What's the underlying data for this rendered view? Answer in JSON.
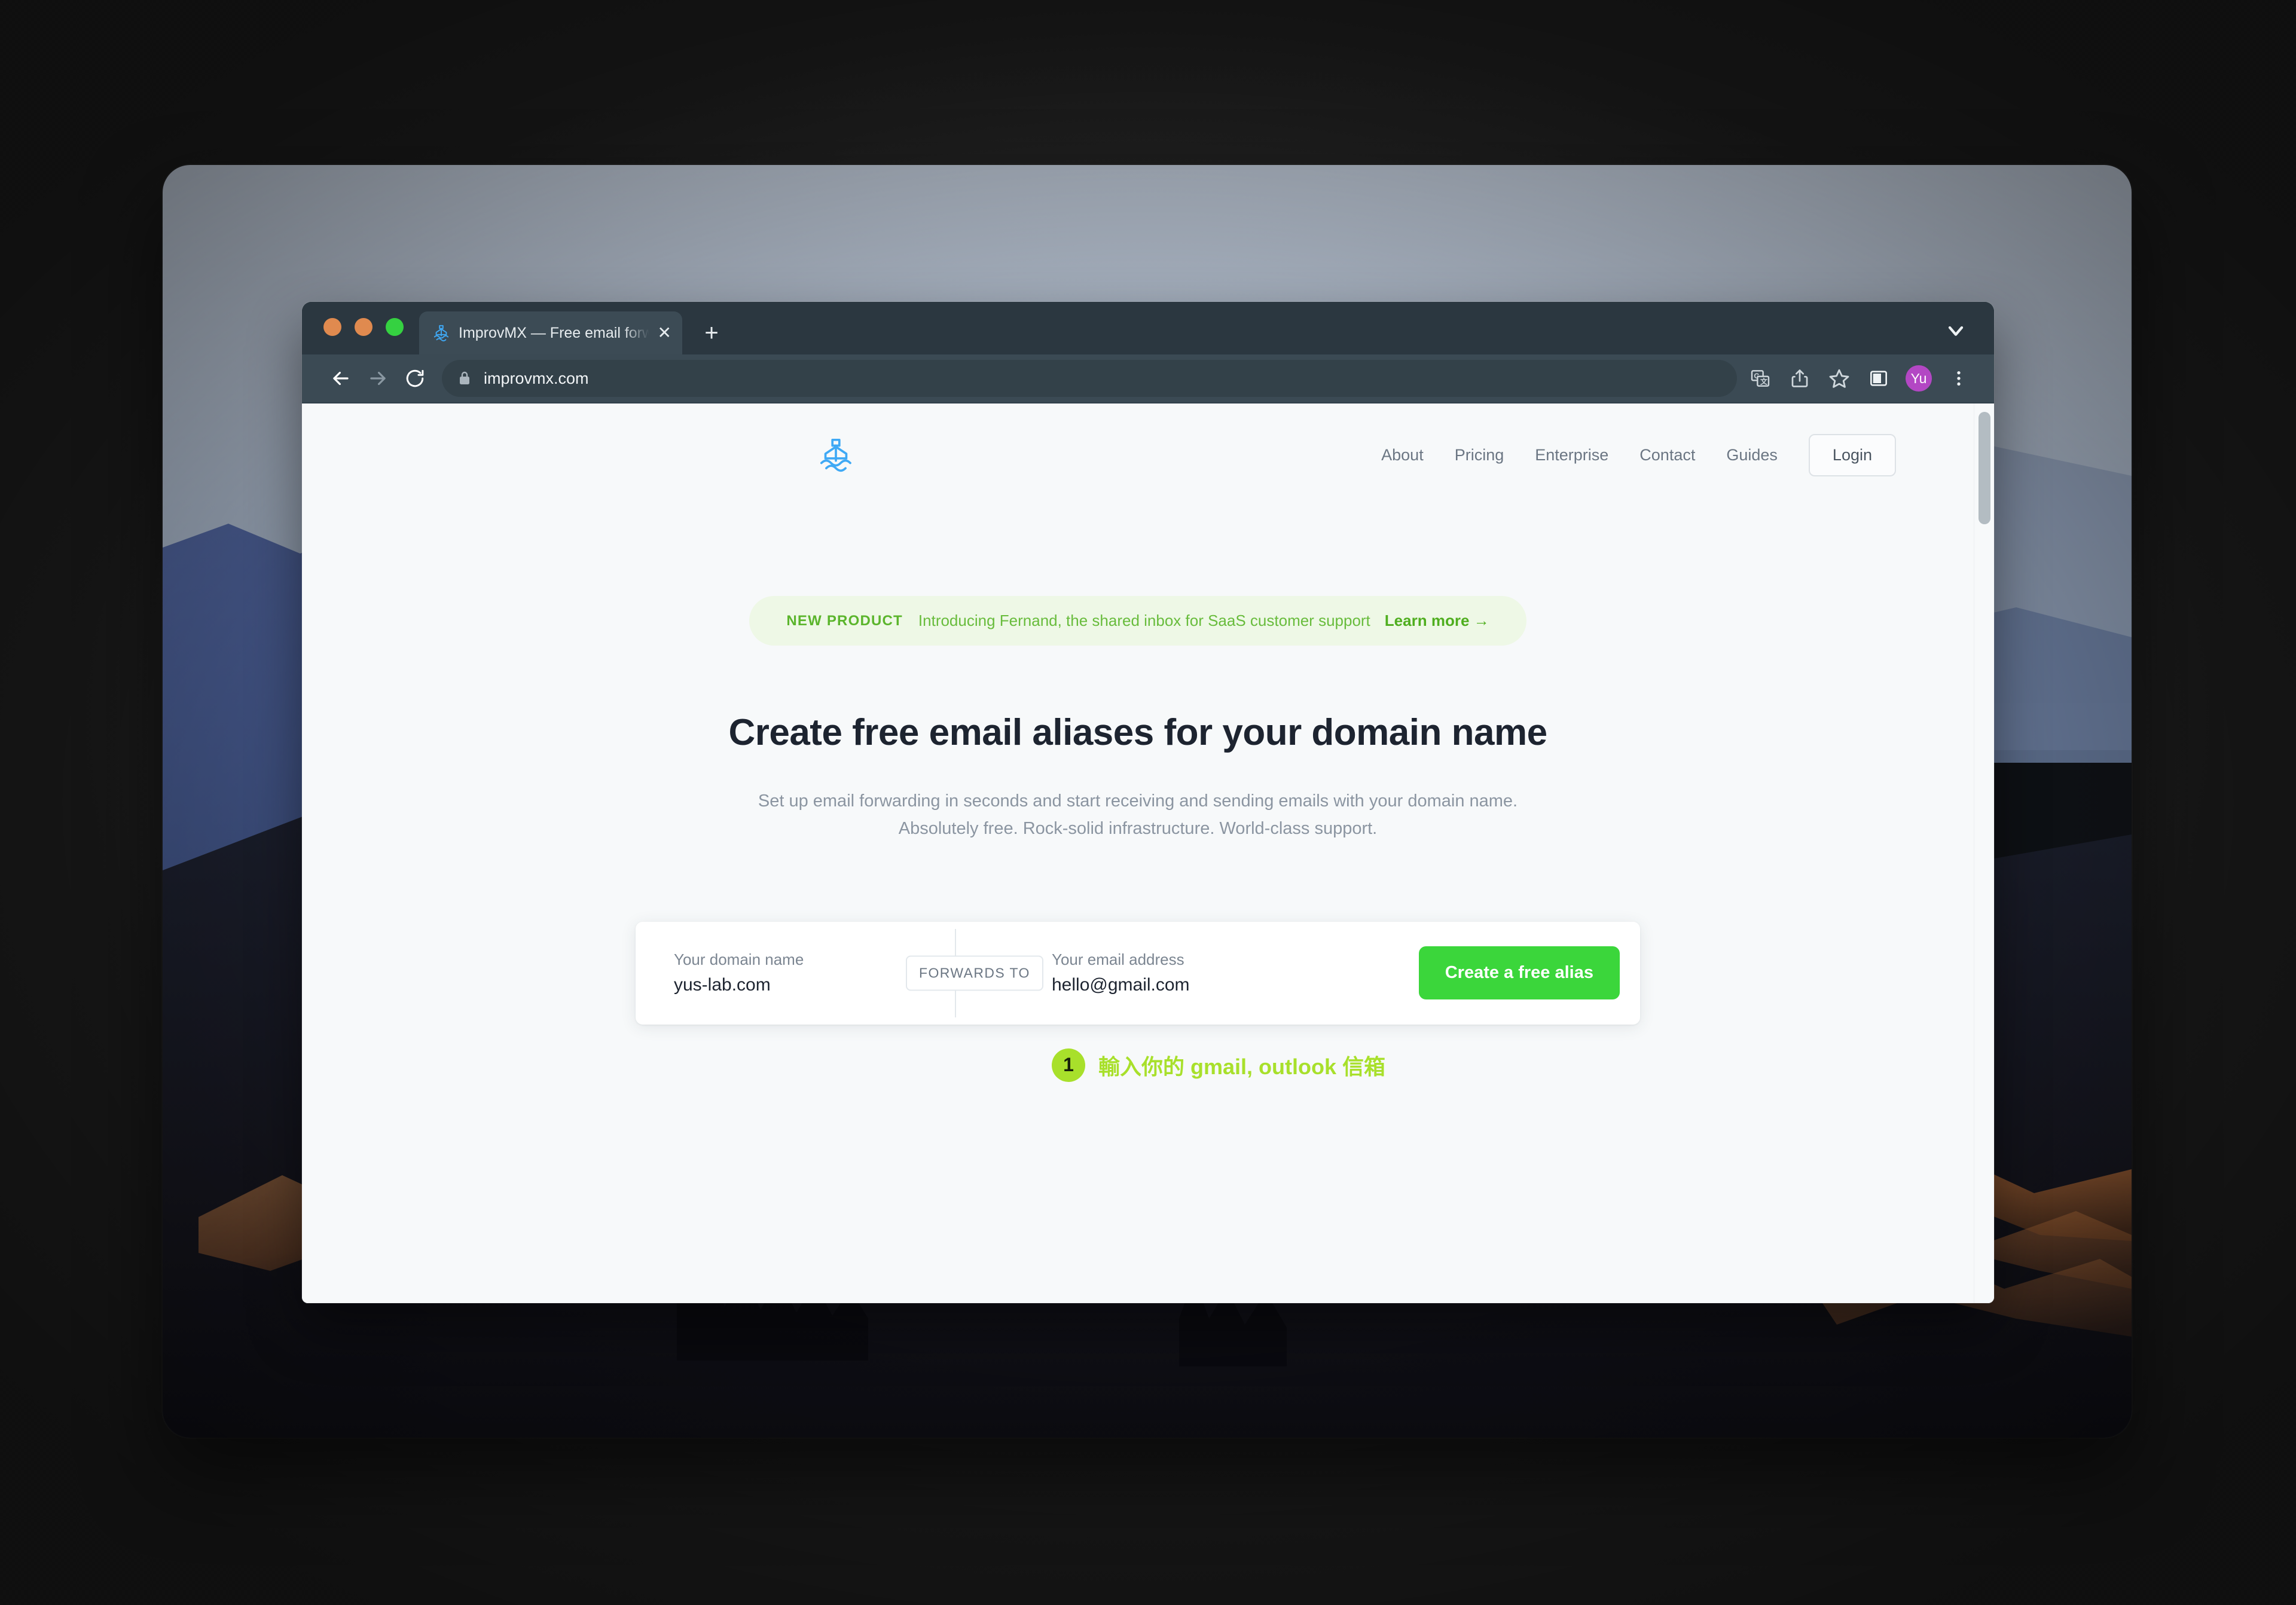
{
  "window_chrome": {
    "traffic_lights": [
      "close",
      "minimize",
      "maximize"
    ],
    "tab": {
      "title": "ImprovMX — Free email forward",
      "favicon": "ship-favicon",
      "close_label": "✕"
    },
    "new_tab_label": "+",
    "tab_search_icon": "chevron-down-icon"
  },
  "toolbar": {
    "back_icon": "back-arrow-icon",
    "forward_icon": "forward-arrow-icon",
    "reload_icon": "reload-icon",
    "lock_icon": "lock-icon",
    "url": "improvmx.com",
    "right_icons": [
      "translate-icon",
      "share-icon",
      "bookmark-star-icon",
      "side-panel-icon"
    ],
    "profile_initials": "Yu",
    "menu_icon": "three-dot-menu-icon"
  },
  "site": {
    "logo": "improvmx-ship-logo",
    "nav": [
      {
        "label": "About"
      },
      {
        "label": "Pricing"
      },
      {
        "label": "Enterprise"
      },
      {
        "label": "Contact"
      },
      {
        "label": "Guides"
      }
    ],
    "login_label": "Login"
  },
  "hero": {
    "banner": {
      "tag": "NEW PRODUCT",
      "text": "Introducing Fernand, the shared inbox for SaaS customer support",
      "link": "Learn more →"
    },
    "title": "Create free email aliases for your domain name",
    "subtitle_line1": "Set up email forwarding in seconds and start receiving and sending emails with your domain name.",
    "subtitle_line2": "Absolutely free. Rock-solid infrastructure. World-class support."
  },
  "signup_form": {
    "domain_label": "Your domain name",
    "domain_value": "yus-lab.com",
    "forwards_to_badge": "FORWARDS TO",
    "email_label": "Your email address",
    "email_value": "hello@gmail.com",
    "submit_label": "Create a free alias"
  },
  "annotation": {
    "step_number": "1",
    "text": "輸入你的 gmail, outlook 信箱"
  },
  "colors": {
    "accent_green": "#3bd63b",
    "annotation_green": "#a8e02b",
    "banner_green": "#68bc3c",
    "banner_bg": "#eef8e6",
    "browser_chrome": "#2b3740",
    "toolbar": "#3b4a54",
    "avatar": "#b347c4",
    "page_bg": "#f7f9fa",
    "logo_blue": "#3fa9f5"
  }
}
